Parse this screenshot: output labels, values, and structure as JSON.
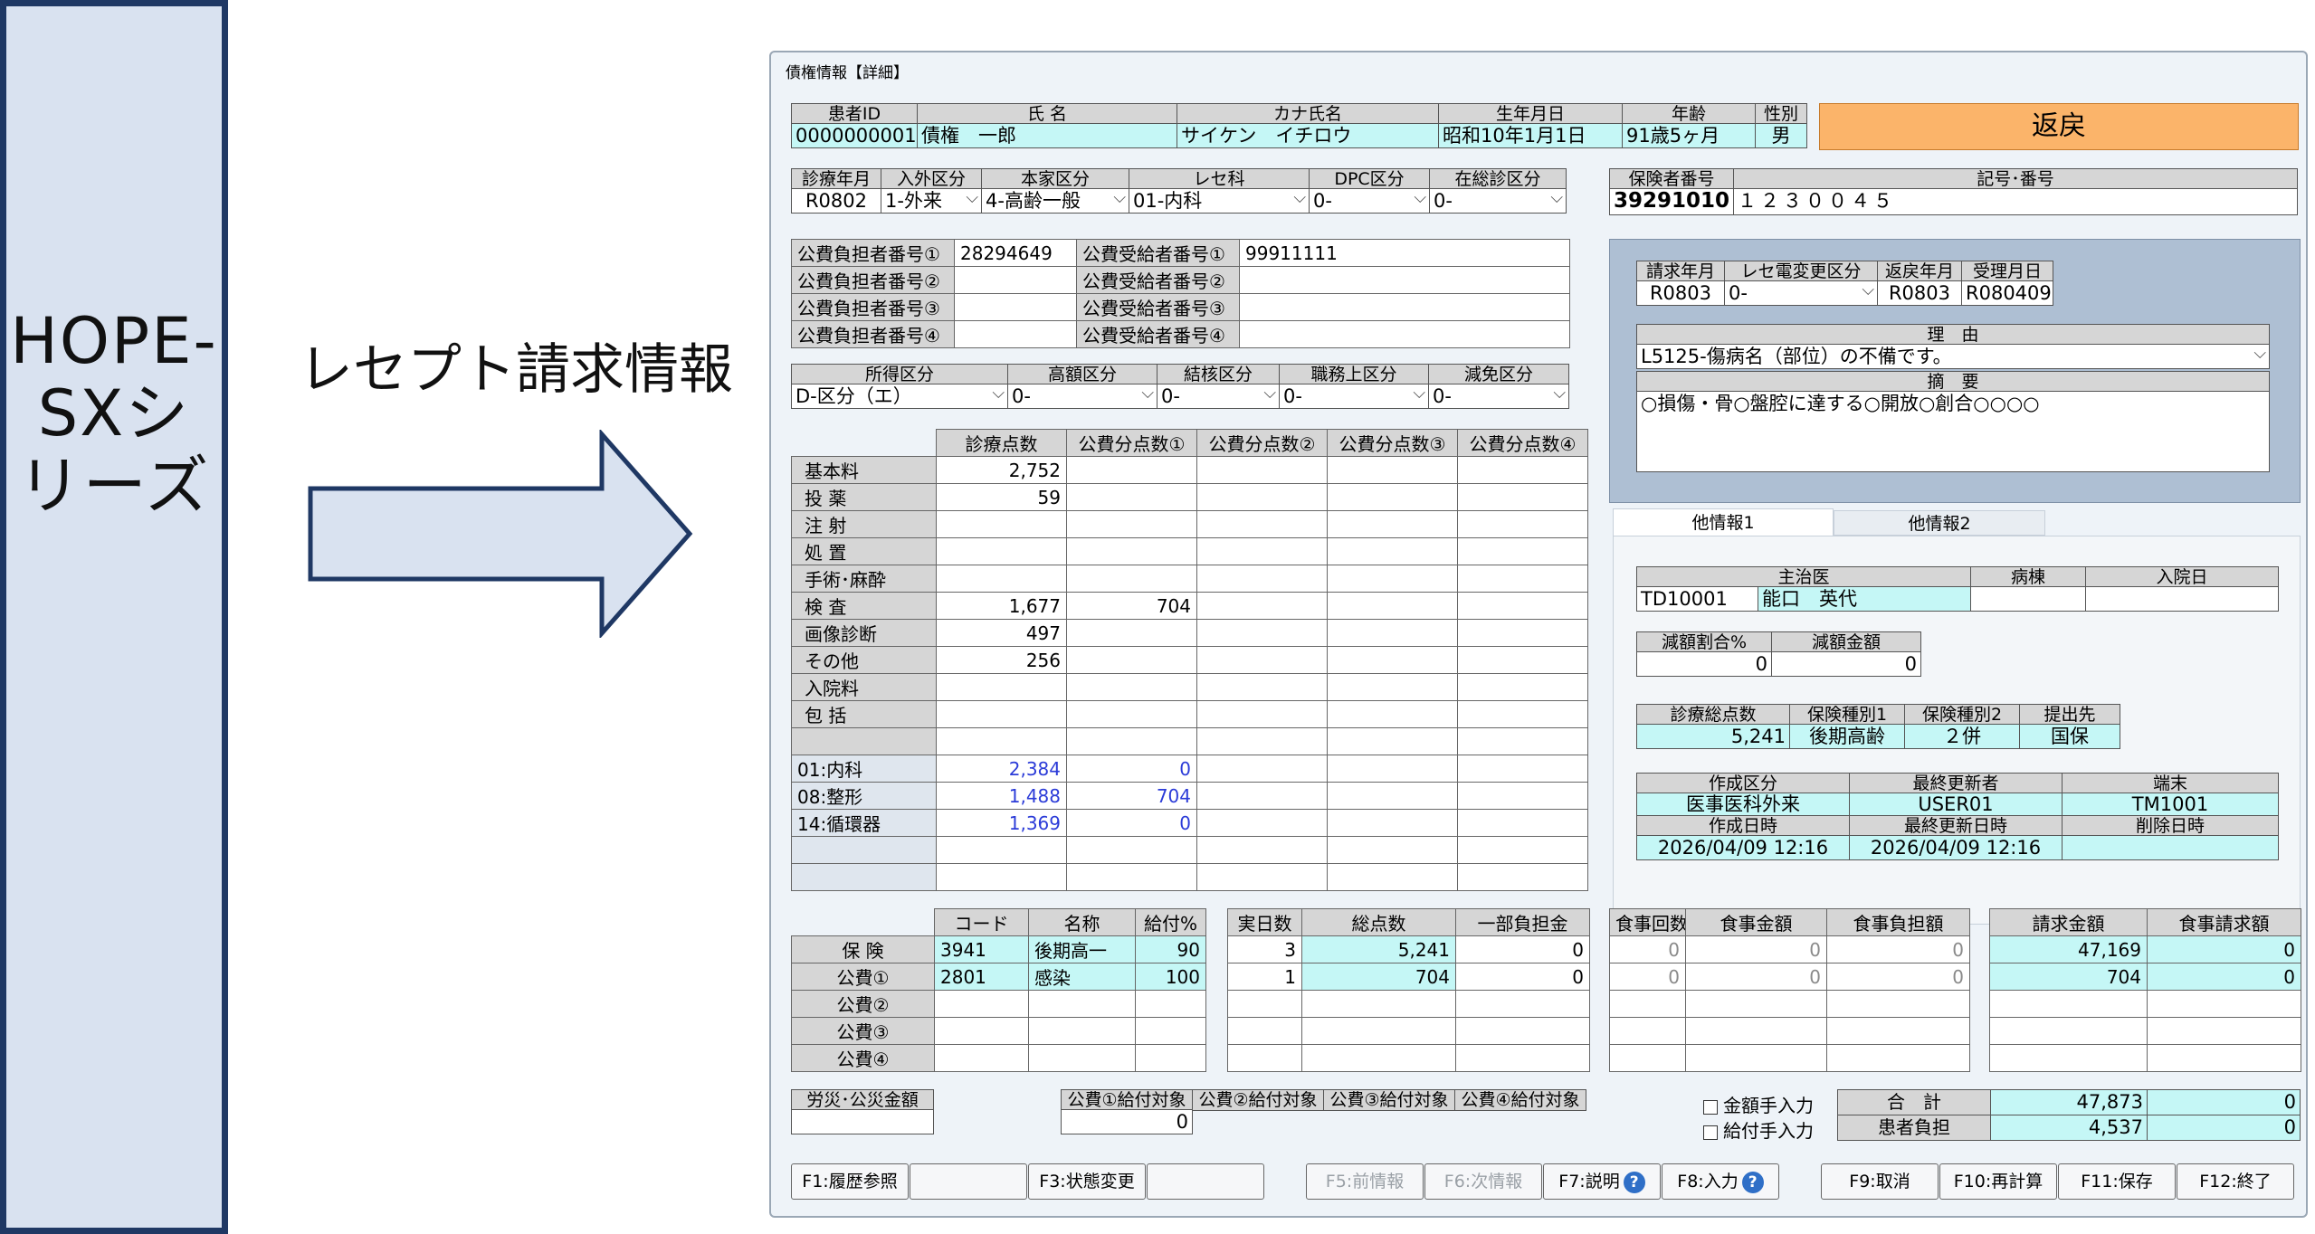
{
  "promo": {
    "side_title": "HOPE-SXシリーズ",
    "caption": "レセプト請求情報"
  },
  "window": {
    "title": "債権情報【詳細】",
    "patient": {
      "headers": [
        "患者ID",
        "氏 名",
        "カナ氏名",
        "生年月日",
        "年齢",
        "性別"
      ],
      "values": [
        "0000000001",
        "債権　一郎",
        "サイケン　イチロウ",
        "昭和10年1月1日",
        "91歳5ヶ月",
        "男"
      ]
    },
    "return_button": "返戻",
    "receipt": {
      "headers": [
        "診療年月",
        "入外区分",
        "本家区分",
        "レセ科",
        "DPC区分",
        "在総診区分"
      ],
      "values": [
        "R0802",
        "1-外来",
        "4-高齢一般",
        "01-内科",
        "0-",
        "0-"
      ]
    },
    "insurer": {
      "headers": [
        "保険者番号",
        "記号･番号"
      ],
      "values": [
        "39291010",
        "１２３００４５"
      ]
    },
    "public": {
      "rows": [
        {
          "label1": "公費負担者番号①",
          "value1": "28294649",
          "label2": "公費受給者番号①",
          "value2": "99911111"
        },
        {
          "label1": "公費負担者番号②",
          "value1": "",
          "label2": "公費受給者番号②",
          "value2": ""
        },
        {
          "label1": "公費負担者番号③",
          "value1": "",
          "label2": "公費受給者番号③",
          "value2": ""
        },
        {
          "label1": "公費負担者番号④",
          "value1": "",
          "label2": "公費受給者番号④",
          "value2": ""
        }
      ]
    },
    "income": {
      "headers": [
        "所得区分",
        "高額区分",
        "結核区分",
        "職務上区分",
        "減免区分"
      ],
      "values": [
        "D-区分（エ）",
        "0-",
        "0-",
        "0-",
        "0-"
      ]
    },
    "points": {
      "headers": [
        "診療点数",
        "公費分点数①",
        "公費分点数②",
        "公費分点数③",
        "公費分点数④"
      ],
      "rows": [
        {
          "label": "基本料",
          "v": [
            "2,752",
            "",
            "",
            "",
            ""
          ]
        },
        {
          "label": "投 薬",
          "v": [
            "59",
            "",
            "",
            "",
            ""
          ]
        },
        {
          "label": "注 射",
          "v": [
            "",
            "",
            "",
            "",
            ""
          ]
        },
        {
          "label": "処 置",
          "v": [
            "",
            "",
            "",
            "",
            ""
          ]
        },
        {
          "label": "手術･麻酔",
          "v": [
            "",
            "",
            "",
            "",
            ""
          ]
        },
        {
          "label": "検 査",
          "v": [
            "1,677",
            "704",
            "",
            "",
            ""
          ]
        },
        {
          "label": "画像診断",
          "v": [
            "497",
            "",
            "",
            "",
            ""
          ]
        },
        {
          "label": "その他",
          "v": [
            "256",
            "",
            "",
            "",
            ""
          ]
        },
        {
          "label": "入院料",
          "v": [
            "",
            "",
            "",
            "",
            ""
          ]
        },
        {
          "label": "包 括",
          "v": [
            "",
            "",
            "",
            "",
            ""
          ]
        },
        {
          "label": "",
          "v": [
            "",
            "",
            "",
            "",
            ""
          ]
        }
      ],
      "dept_rows": [
        {
          "label": "01:内科",
          "v": [
            "2,384",
            "0",
            "",
            "",
            ""
          ]
        },
        {
          "label": "08:整形",
          "v": [
            "1,488",
            "704",
            "",
            "",
            ""
          ]
        },
        {
          "label": "14:循環器",
          "v": [
            "1,369",
            "0",
            "",
            "",
            ""
          ]
        },
        {
          "label": "",
          "v": [
            "",
            "",
            "",
            "",
            ""
          ]
        },
        {
          "label": "",
          "v": [
            "",
            "",
            "",
            "",
            ""
          ]
        }
      ]
    },
    "claim": {
      "headers": [
        "請求年月",
        "レセ電変更区分",
        "返戻年月",
        "受理月日"
      ],
      "values": [
        "R0803",
        "0-",
        "R0803",
        "R080409"
      ],
      "reason_label": "理　由",
      "reason_value": "L5125-傷病名（部位）の不備です。",
      "summary_label": "摘　要",
      "summary_value": "○損傷・骨○盤腔に達する○開放○創合○○○○"
    },
    "tabs": [
      "他情報1",
      "他情報2"
    ],
    "other": {
      "doctor_headers": [
        "主治医",
        "病棟",
        "入院日"
      ],
      "doctor_code": "TD10001",
      "doctor_name": "能口　英代",
      "ward": "",
      "admit_date": "",
      "reduce_headers": [
        "減額割合%",
        "減額金額"
      ],
      "reduce_values": [
        "0",
        "0"
      ],
      "ins_headers": [
        "診療総点数",
        "保険種別1",
        "保険種別2",
        "提出先"
      ],
      "ins_values": [
        "5,241",
        "後期高齢",
        "２併",
        "国保"
      ],
      "create_headers": [
        "作成区分",
        "最終更新者",
        "端末"
      ],
      "create_values": [
        "医事医科外来",
        "USER01",
        "TM1001"
      ],
      "date_headers": [
        "作成日時",
        "最終更新日時",
        "削除日時"
      ],
      "date_values": [
        "2026/04/09 12:16",
        "2026/04/09 12:16",
        ""
      ]
    },
    "insurance_table": {
      "headers": [
        "コード",
        "名称",
        "給付%"
      ],
      "rows": [
        {
          "label": "保 険",
          "code": "3941",
          "name": "後期高一",
          "rate": "90"
        },
        {
          "label": "公費①",
          "code": "2801",
          "name": "感染",
          "rate": "100"
        },
        {
          "label": "公費②",
          "code": "",
          "name": "",
          "rate": ""
        },
        {
          "label": "公費③",
          "code": "",
          "name": "",
          "rate": ""
        },
        {
          "label": "公費④",
          "code": "",
          "name": "",
          "rate": ""
        }
      ]
    },
    "days_table": {
      "headers": [
        "実日数",
        "総点数",
        "一部負担金"
      ],
      "rows": [
        [
          "3",
          "5,241",
          "0"
        ],
        [
          "1",
          "704",
          "0"
        ],
        [
          "",
          "",
          ""
        ],
        [
          "",
          "",
          ""
        ],
        [
          "",
          "",
          ""
        ]
      ]
    },
    "meal_table": {
      "headers": [
        "食事回数",
        "食事金額",
        "食事負担額"
      ],
      "rows": [
        [
          "0",
          "0",
          "0"
        ],
        [
          "0",
          "0",
          "0"
        ],
        [
          "",
          "",
          ""
        ],
        [
          "",
          "",
          ""
        ],
        [
          "",
          "",
          ""
        ]
      ]
    },
    "bill_table": {
      "headers": [
        "請求金額",
        "食事請求額"
      ],
      "rows": [
        [
          "47,169",
          "0"
        ],
        [
          "704",
          "0"
        ],
        [
          "",
          ""
        ],
        [
          "",
          ""
        ],
        [
          "",
          ""
        ]
      ]
    },
    "labor_label": "労災･公災金額",
    "labor_value": "",
    "benefit": {
      "headers": [
        "公費①給付対象",
        "公費②給付対象",
        "公費③給付対象",
        "公費④給付対象"
      ],
      "values": [
        "0",
        "",
        "",
        ""
      ]
    },
    "checks": [
      "金額手入力",
      "給付手入力"
    ],
    "totals": {
      "total_label": "合　計",
      "total_value": "47,873",
      "total_value2": "0",
      "patient_label": "患者負担",
      "patient_value": "4,537",
      "patient_value2": "0"
    },
    "fkeys": [
      {
        "label": "F1:履歴参照",
        "enabled": true
      },
      {
        "label": "",
        "enabled": true
      },
      {
        "label": "F3:状態変更",
        "enabled": true
      },
      {
        "label": "",
        "enabled": true
      },
      {
        "label": "F5:前情報",
        "enabled": false
      },
      {
        "label": "F6:次情報",
        "enabled": false
      },
      {
        "label": "F7:説明",
        "enabled": true,
        "help": "?"
      },
      {
        "label": "F8:入力",
        "enabled": true,
        "help": "?"
      },
      {
        "label": "F9:取消",
        "enabled": true
      },
      {
        "label": "F10:再計算",
        "enabled": true
      },
      {
        "label": "F11:保存",
        "enabled": true
      },
      {
        "label": "F12:終了",
        "enabled": true
      }
    ]
  }
}
